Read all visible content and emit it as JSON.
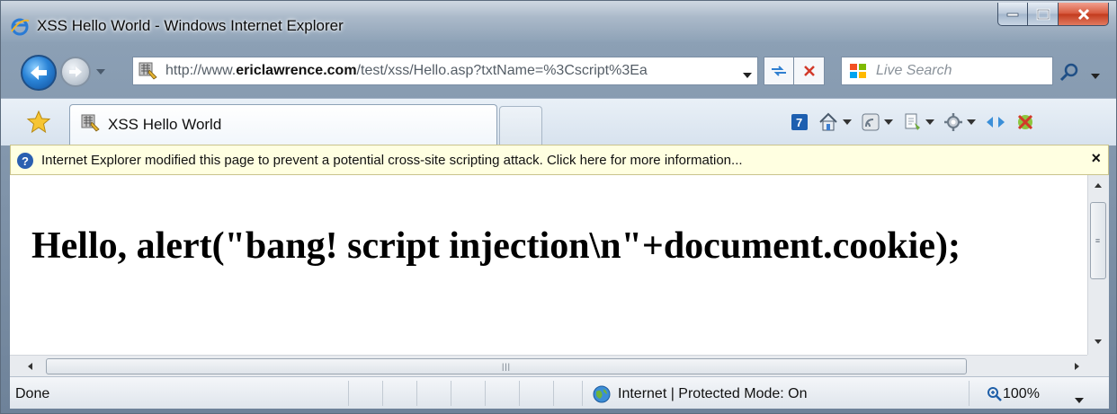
{
  "window": {
    "title": "XSS Hello World - Windows Internet Explorer"
  },
  "address": {
    "url_prefix": "http://www.",
    "url_domain": "ericlawrence.com",
    "url_rest": "/test/xss/Hello.asp?txtName=%3Cscript%3Ea"
  },
  "search": {
    "placeholder": "Live Search"
  },
  "tabs": [
    {
      "label": "XSS Hello World",
      "active": true
    }
  ],
  "command_bar": {
    "icons": [
      "help-icon",
      "home-icon",
      "feeds-icon",
      "print-icon",
      "tools-icon",
      "research-icon",
      "block-icon"
    ]
  },
  "infobar": {
    "message": "Internet Explorer modified this page to prevent a potential cross-site scripting attack.  Click here for more information...",
    "close": "×"
  },
  "content": {
    "heading": "Hello, alert(\"bang! script injection\\n\"+document.cookie);"
  },
  "status": {
    "text": "Done",
    "zone": "Internet | Protected Mode: On",
    "zoom": "100%"
  },
  "colors": {
    "infobar_bg": "#ffffe1",
    "close_red": "#c23a1d",
    "back_blue": "#2a83d6"
  }
}
